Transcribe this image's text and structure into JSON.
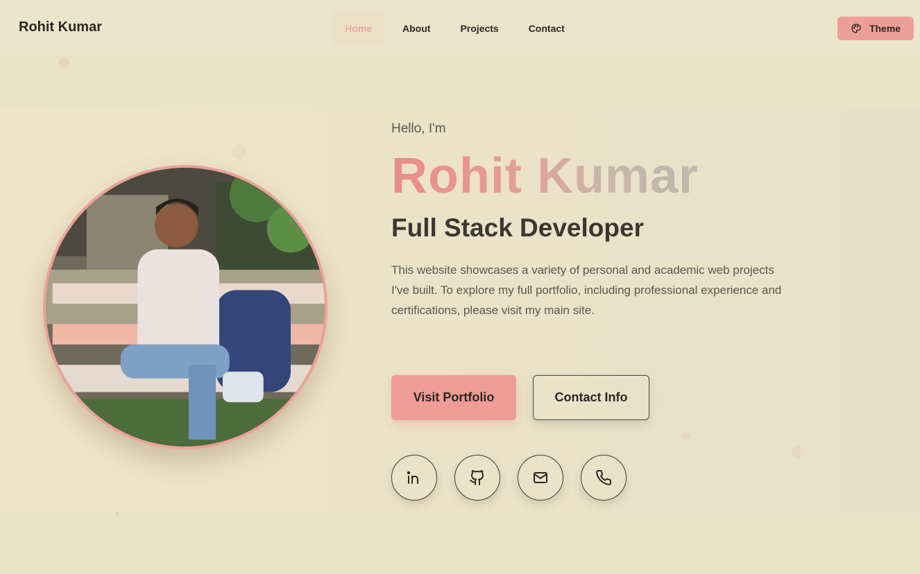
{
  "nav": {
    "brand": "Rohit Kumar",
    "links": [
      {
        "label": "Home",
        "active": true
      },
      {
        "label": "About"
      },
      {
        "label": "Projects"
      },
      {
        "label": "Contact"
      }
    ],
    "theme_button": {
      "label": "Theme",
      "icon": "palette-icon"
    }
  },
  "hero": {
    "greeting": "Hello, I'm",
    "name": "Rohit Kumar",
    "role": "Full Stack Developer",
    "bio": "This website showcases a variety of personal and academic web projects I've built. To explore my full portfolio, including professional experience and certifications, please visit my main site.",
    "primary_button": "Visit Portfolio",
    "secondary_button": "Contact Info",
    "socials": [
      "linkedin-icon",
      "github-icon",
      "mail-icon",
      "phone-icon"
    ]
  },
  "colors": {
    "background": "#ebe3c8",
    "accent": "#ee9c96",
    "text": "#2d2522"
  }
}
